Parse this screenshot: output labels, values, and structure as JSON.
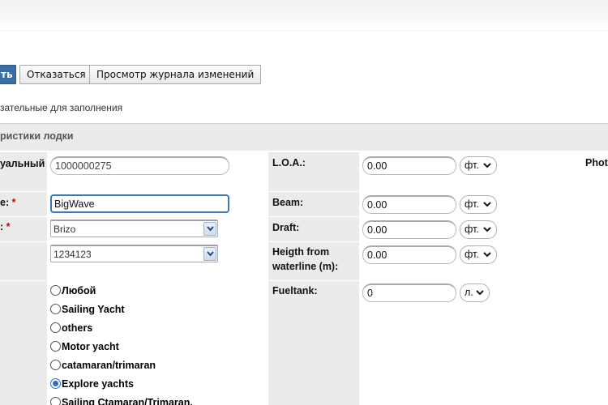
{
  "toolbar": {
    "save_label": "ть",
    "cancel_label": "Отказаться",
    "history_label": "Просмотр журнала изменений"
  },
  "required_note": "зательные для заполнения",
  "section_title": "ристики лодки",
  "left_fields": {
    "id_label": "уальный",
    "id_value": "1000000275",
    "name_label": "e:",
    "name_value": "BigWave",
    "brand_label": ":",
    "brand_value": "Brizo",
    "model_value": "1234123"
  },
  "right_fields": {
    "loa_label": "L.O.A.:",
    "loa_value": "0.00",
    "loa_unit": "фт.",
    "beam_label": "Beam:",
    "beam_value": "0.00",
    "beam_unit": "фт.",
    "draft_label": "Draft:",
    "draft_value": "0.00",
    "draft_unit": "фт.",
    "height_label_1": "Heigth from",
    "height_label_2": "waterline (m):",
    "height_value": "0.00",
    "height_unit": "фт.",
    "fuel_label": "Fueltank:",
    "fuel_value": "0",
    "fuel_unit": "л."
  },
  "photo_label": "Phot",
  "required_mark": "*",
  "boat_types": [
    {
      "label": "Любой",
      "checked": false
    },
    {
      "label": "Sailing Yacht",
      "checked": false
    },
    {
      "label": "others",
      "checked": false
    },
    {
      "label": "Motor yacht",
      "checked": false
    },
    {
      "label": "catamaran/trimaran",
      "checked": false
    },
    {
      "label": "Explore yachts",
      "checked": true
    },
    {
      "label": "Sailing Ctamaran/Trimaran.",
      "checked": false
    }
  ]
}
